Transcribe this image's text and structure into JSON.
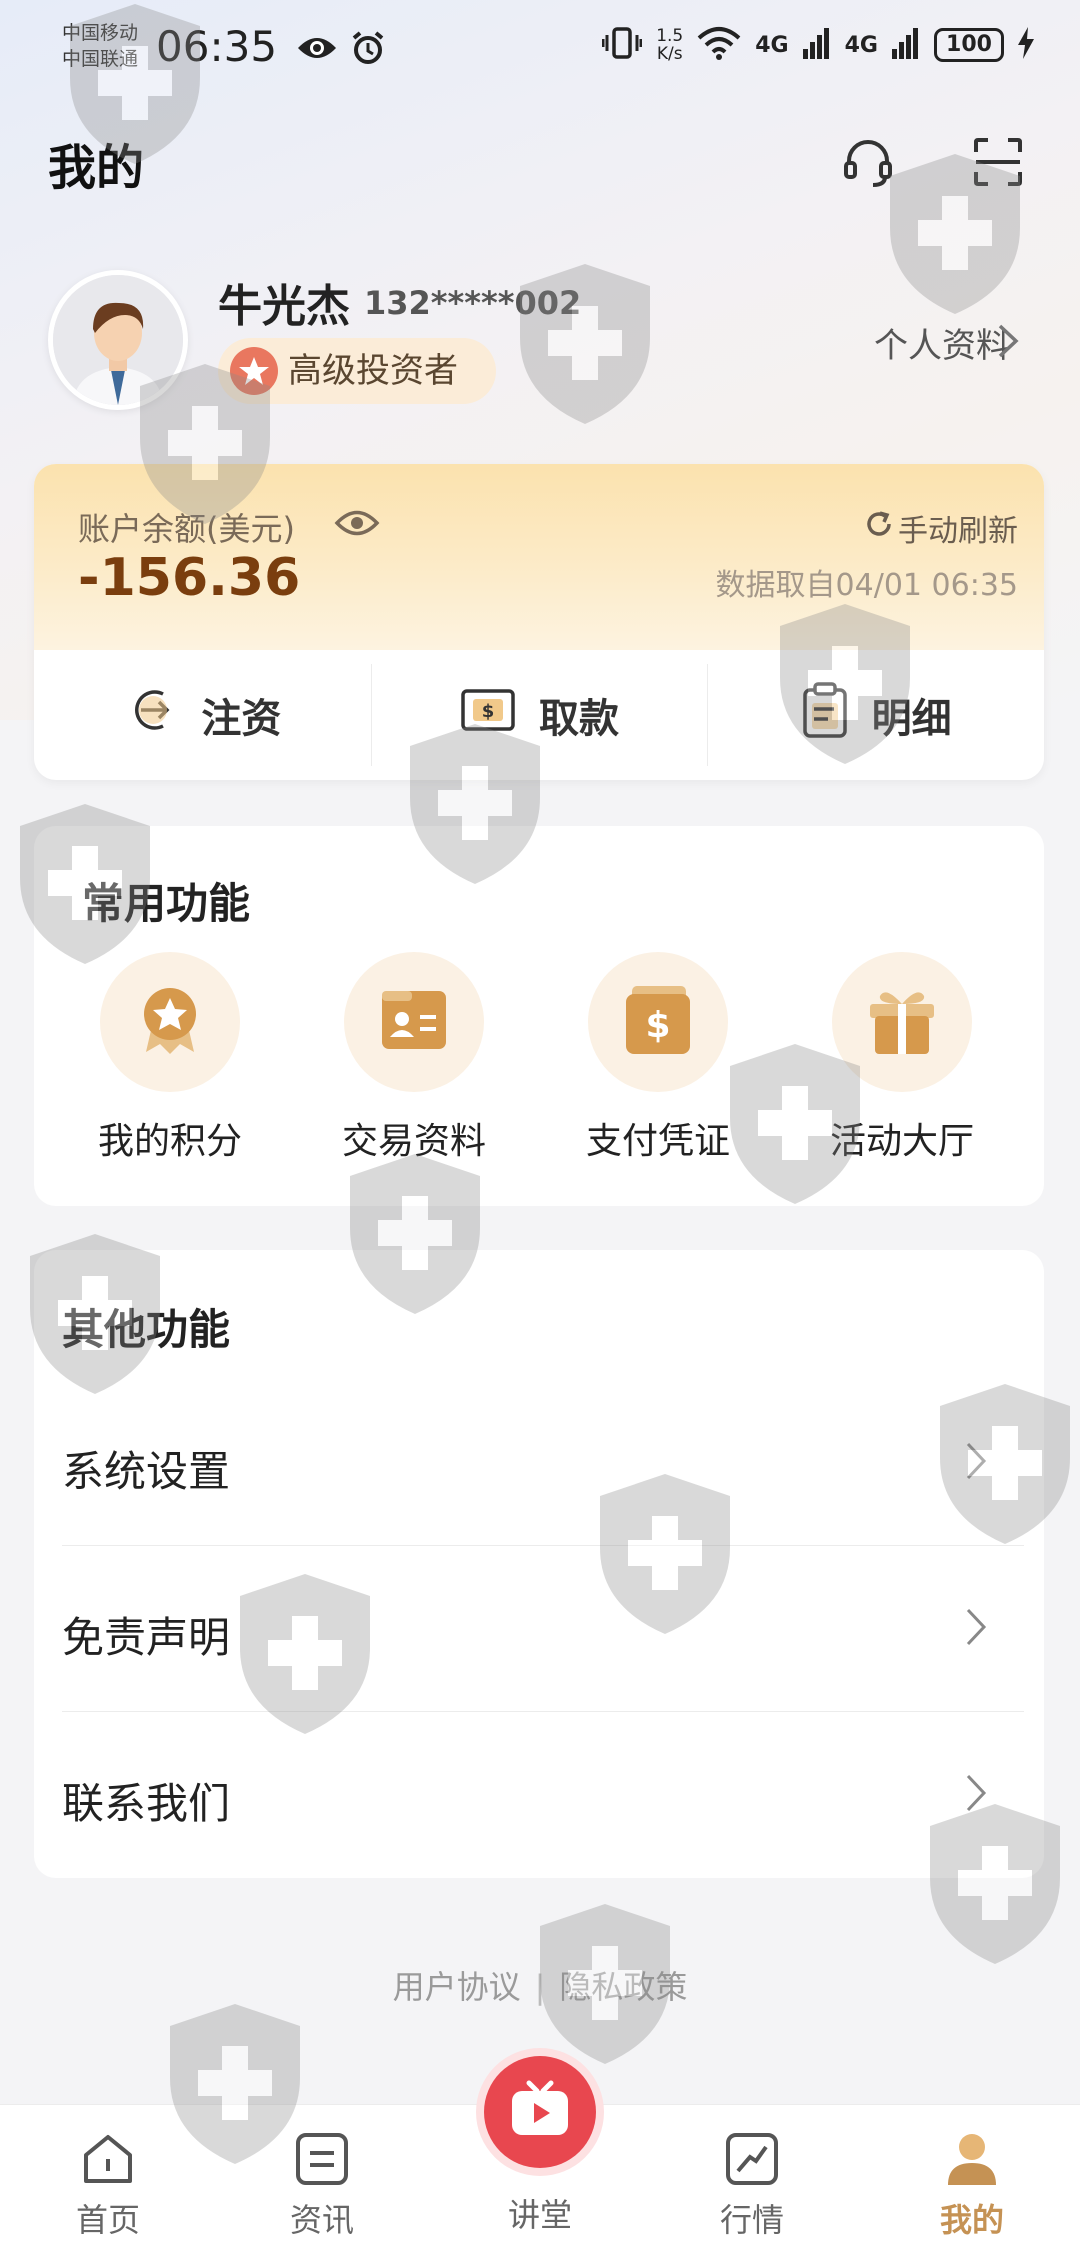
{
  "status_bar": {
    "carrier_1": "中国移动",
    "carrier_2": "中国联通",
    "time": "06:35",
    "net_speed_value": "1.5",
    "net_speed_unit": "K/s",
    "signal_1": "4G",
    "signal_2": "4G",
    "battery": "100"
  },
  "header": {
    "title": "我的",
    "support_icon": "headset-icon",
    "scan_icon": "scan-icon"
  },
  "profile": {
    "name": "牛光杰",
    "phone": "132*****002",
    "level": "高级投资者",
    "profile_link": "个人资料"
  },
  "account": {
    "balance_label": "账户余额(美元)",
    "balance": "-156.36",
    "refresh_label": "手动刷新",
    "data_time": "数据取自04/01 06:35",
    "actions": [
      {
        "label": "注资",
        "icon": "deposit-icon"
      },
      {
        "label": "取款",
        "icon": "withdraw-icon"
      },
      {
        "label": "明细",
        "icon": "details-icon"
      }
    ]
  },
  "common_functions": {
    "title": "常用功能",
    "items": [
      {
        "label": "我的积分",
        "icon": "points-medal-icon"
      },
      {
        "label": "交易资料",
        "icon": "id-card-icon"
      },
      {
        "label": "支付凭证",
        "icon": "dollar-receipt-icon"
      },
      {
        "label": "活动大厅",
        "icon": "gift-icon"
      }
    ]
  },
  "other_functions": {
    "title": "其他功能",
    "items": [
      {
        "label": "系统设置"
      },
      {
        "label": "免责声明"
      },
      {
        "label": "联系我们"
      }
    ]
  },
  "footer": {
    "user_agreement": "用户协议",
    "separator": "|",
    "privacy_policy": "隐私政策"
  },
  "tab_bar": {
    "items": [
      {
        "label": "首页",
        "icon": "home-icon"
      },
      {
        "label": "资讯",
        "icon": "news-icon"
      },
      {
        "label": "讲堂",
        "icon": "tv-play-icon"
      },
      {
        "label": "行情",
        "icon": "market-chart-icon"
      },
      {
        "label": "我的",
        "icon": "person-icon",
        "active": true
      }
    ]
  },
  "colors": {
    "accent_gold": "#c59254",
    "balance_color": "#7a3e0e",
    "live_red": "#e8474f"
  }
}
